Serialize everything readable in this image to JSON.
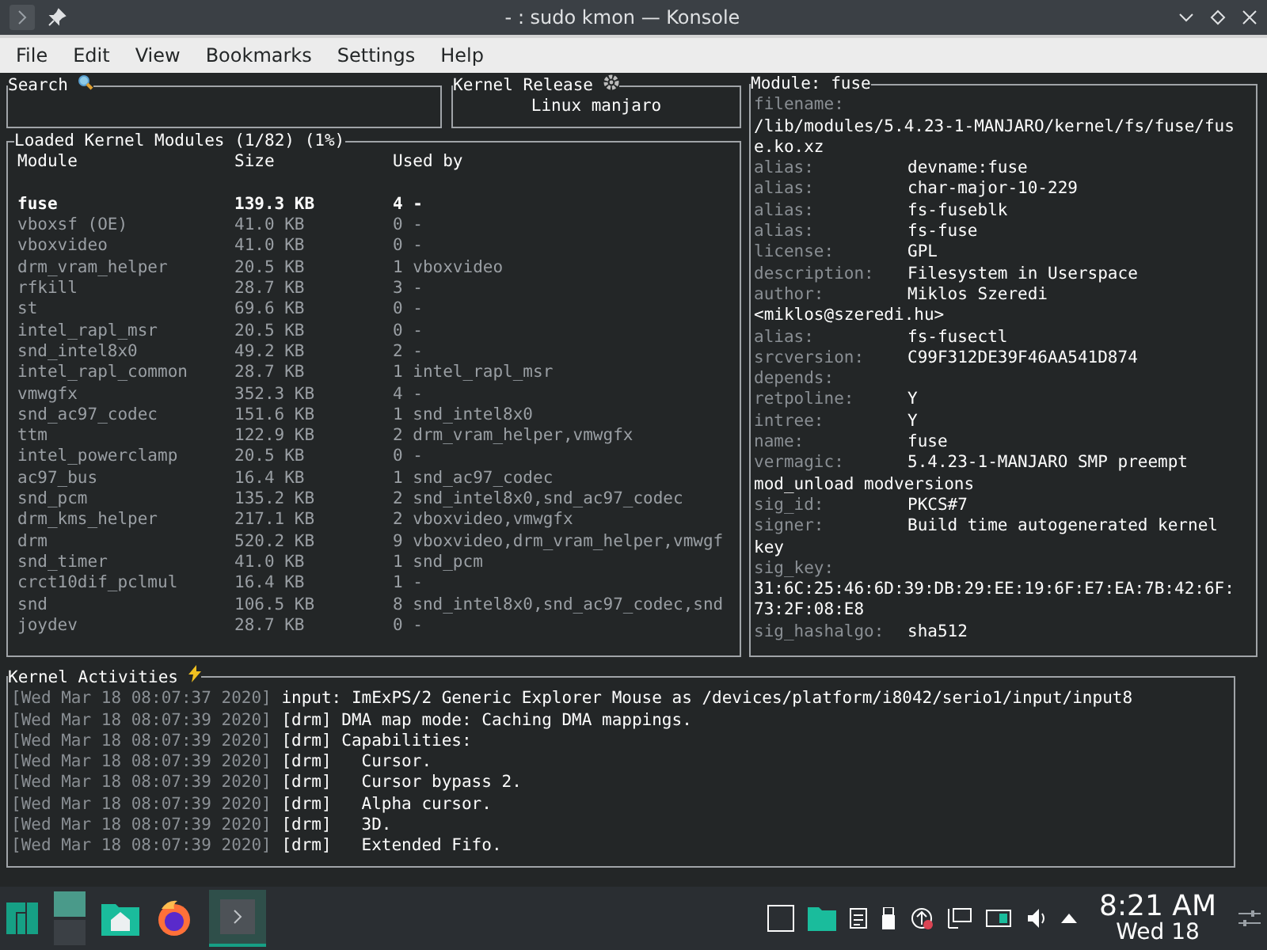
{
  "window": {
    "title": "- : sudo kmon — Konsole"
  },
  "menu": [
    "File",
    "Edit",
    "View",
    "Bookmarks",
    "Settings",
    "Help"
  ],
  "search": {
    "title": "Search"
  },
  "kernel_release": {
    "title": "Kernel Release",
    "value": "Linux manjaro"
  },
  "modules": {
    "title": "Loaded Kernel Modules (1/82) (1%)",
    "columns": [
      "Module",
      "Size",
      "Used by"
    ],
    "rows": [
      {
        "module": "fuse",
        "size": "139.3 KB",
        "used_by": "4 -",
        "selected": true
      },
      {
        "module": "vboxsf (OE)",
        "size": "41.0 KB",
        "used_by": "0 -",
        "selected": false
      },
      {
        "module": "vboxvideo",
        "size": "41.0 KB",
        "used_by": "0 -",
        "selected": false
      },
      {
        "module": "drm_vram_helper",
        "size": "20.5 KB",
        "used_by": "1 vboxvideo",
        "selected": false
      },
      {
        "module": "rfkill",
        "size": "28.7 KB",
        "used_by": "3 -",
        "selected": false
      },
      {
        "module": "st",
        "size": "69.6 KB",
        "used_by": "0 -",
        "selected": false
      },
      {
        "module": "intel_rapl_msr",
        "size": "20.5 KB",
        "used_by": "0 -",
        "selected": false
      },
      {
        "module": "snd_intel8x0",
        "size": "49.2 KB",
        "used_by": "2 -",
        "selected": false
      },
      {
        "module": "intel_rapl_common",
        "size": "28.7 KB",
        "used_by": "1 intel_rapl_msr",
        "selected": false
      },
      {
        "module": "vmwgfx",
        "size": "352.3 KB",
        "used_by": "4 -",
        "selected": false
      },
      {
        "module": "snd_ac97_codec",
        "size": "151.6 KB",
        "used_by": "1 snd_intel8x0",
        "selected": false
      },
      {
        "module": "ttm",
        "size": "122.9 KB",
        "used_by": "2 drm_vram_helper,vmwgfx",
        "selected": false
      },
      {
        "module": "intel_powerclamp",
        "size": "20.5 KB",
        "used_by": "0 -",
        "selected": false
      },
      {
        "module": "ac97_bus",
        "size": "16.4 KB",
        "used_by": "1 snd_ac97_codec",
        "selected": false
      },
      {
        "module": "snd_pcm",
        "size": "135.2 KB",
        "used_by": "2 snd_intel8x0,snd_ac97_codec",
        "selected": false
      },
      {
        "module": "drm_kms_helper",
        "size": "217.1 KB",
        "used_by": "2 vboxvideo,vmwgfx",
        "selected": false
      },
      {
        "module": "drm",
        "size": "520.2 KB",
        "used_by": "9 vboxvideo,drm_vram_helper,vmwgf",
        "selected": false
      },
      {
        "module": "snd_timer",
        "size": "41.0 KB",
        "used_by": "1 snd_pcm",
        "selected": false
      },
      {
        "module": "crct10dif_pclmul",
        "size": "16.4 KB",
        "used_by": "1 -",
        "selected": false
      },
      {
        "module": "snd",
        "size": "106.5 KB",
        "used_by": "8 snd_intel8x0,snd_ac97_codec,snd",
        "selected": false
      },
      {
        "module": "joydev",
        "size": "28.7 KB",
        "used_by": "0 -",
        "selected": false
      }
    ]
  },
  "module_info": {
    "title": "Module: fuse",
    "lines": [
      {
        "key": "filename:"
      },
      {
        "value": "/lib/modules/5.4.23-1-MANJARO/kernel/fs/fuse/fus"
      },
      {
        "value": "e.ko.xz"
      },
      {
        "key": "alias:",
        "value": "devname:fuse"
      },
      {
        "key": "alias:",
        "value": "char-major-10-229"
      },
      {
        "key": "alias:",
        "value": "fs-fuseblk"
      },
      {
        "key": "alias:",
        "value": "fs-fuse"
      },
      {
        "key": "license:",
        "value": "GPL"
      },
      {
        "key": "description:",
        "value": "Filesystem in Userspace"
      },
      {
        "key": "author:",
        "value": "Miklos Szeredi"
      },
      {
        "value": "<miklos@szeredi.hu>"
      },
      {
        "key": "alias:",
        "value": "fs-fusectl"
      },
      {
        "key": "srcversion:",
        "value": "C99F312DE39F46AA541D874"
      },
      {
        "key": "depends:"
      },
      {
        "key": "retpoline:",
        "value": "Y"
      },
      {
        "key": "intree:",
        "value": "Y"
      },
      {
        "key": "name:",
        "value": "fuse"
      },
      {
        "key": "vermagic:",
        "value": "5.4.23-1-MANJARO SMP preempt"
      },
      {
        "value": "mod_unload modversions"
      },
      {
        "key": "sig_id:",
        "value": "PKCS#7"
      },
      {
        "key": "signer:",
        "value": "Build time autogenerated kernel"
      },
      {
        "value": "key"
      },
      {
        "key": "sig_key:"
      },
      {
        "value": "31:6C:25:46:6D:39:DB:29:EE:19:6F:E7:EA:7B:42:6F:"
      },
      {
        "value": "73:2F:08:E8"
      },
      {
        "key": "sig_hashalgo:",
        "value": "sha512"
      }
    ]
  },
  "activities": {
    "title": "Kernel Activities",
    "lines": [
      {
        "time": "[Wed Mar 18 08:07:37 2020]",
        "message": "input: ImExPS/2 Generic Explorer Mouse as /devices/platform/i8042/serio1/input/input8"
      },
      {
        "time": "[Wed Mar 18 08:07:39 2020]",
        "message": "[drm] DMA map mode: Caching DMA mappings."
      },
      {
        "time": "[Wed Mar 18 08:07:39 2020]",
        "message": "[drm] Capabilities:"
      },
      {
        "time": "[Wed Mar 18 08:07:39 2020]",
        "message": "[drm]   Cursor."
      },
      {
        "time": "[Wed Mar 18 08:07:39 2020]",
        "message": "[drm]   Cursor bypass 2."
      },
      {
        "time": "[Wed Mar 18 08:07:39 2020]",
        "message": "[drm]   Alpha cursor."
      },
      {
        "time": "[Wed Mar 18 08:07:39 2020]",
        "message": "[drm]   3D."
      },
      {
        "time": "[Wed Mar 18 08:07:39 2020]",
        "message": "[drm]   Extended Fifo."
      }
    ]
  },
  "taskbar": {
    "clock_time": "8:21 AM",
    "clock_date": "Wed 18"
  }
}
